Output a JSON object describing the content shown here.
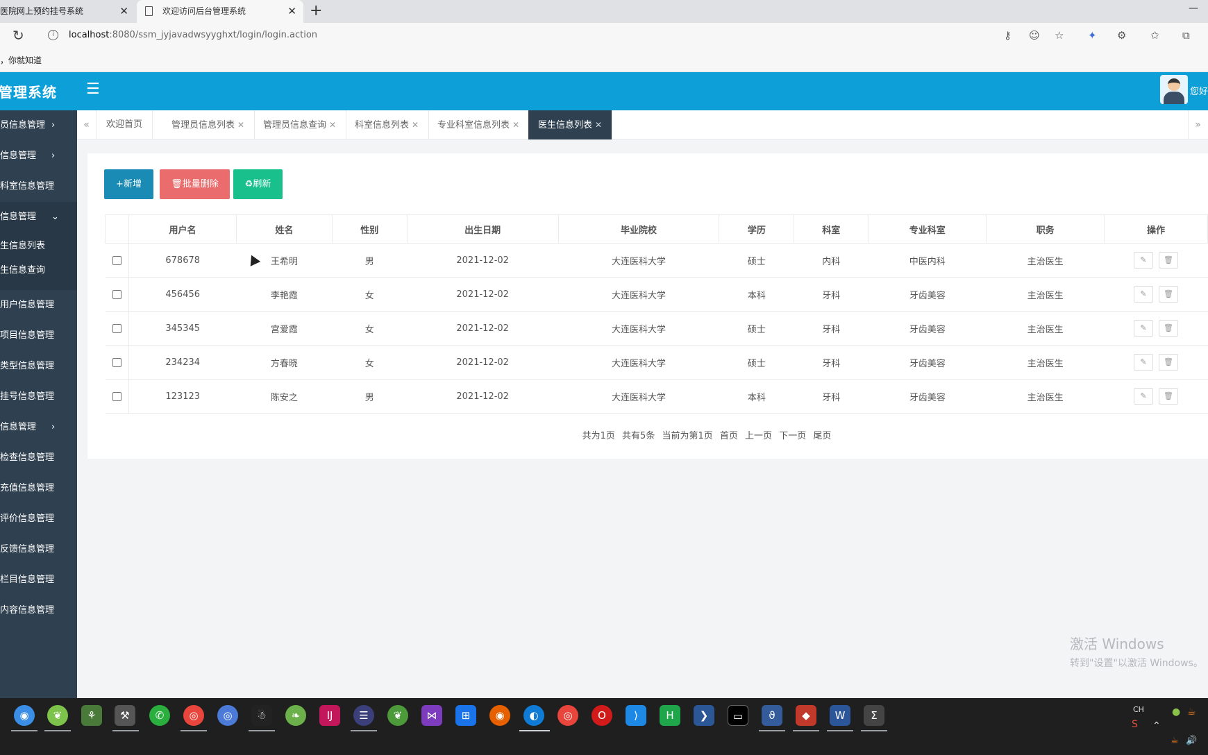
{
  "browser": {
    "tabs": [
      {
        "title": "医院网上预约挂号系统"
      },
      {
        "title": "欢迎访问后台管理系统"
      }
    ],
    "url_host": "localhost",
    "url_rest": ":8080/ssm_jyjavadwsyyghxt/login/login.action",
    "bookmark": "，你就知道"
  },
  "app": {
    "title": "管理系统",
    "greeting": "您好"
  },
  "sidebar": {
    "items": [
      {
        "label": "员信息管理"
      },
      {
        "label": "信息管理"
      },
      {
        "label": "科室信息管理"
      },
      {
        "label": "信息管理"
      },
      {
        "label": "生信息列表"
      },
      {
        "label": "生信息查询"
      },
      {
        "label": "用户信息管理"
      },
      {
        "label": "项目信息管理"
      },
      {
        "label": "类型信息管理"
      },
      {
        "label": "挂号信息管理"
      },
      {
        "label": "信息管理"
      },
      {
        "label": "检查信息管理"
      },
      {
        "label": "充值信息管理"
      },
      {
        "label": "评价信息管理"
      },
      {
        "label": "反馈信息管理"
      },
      {
        "label": "栏目信息管理"
      },
      {
        "label": "内容信息管理"
      }
    ]
  },
  "page_tabs": [
    {
      "label": "欢迎首页"
    },
    {
      "label": "管理员信息列表"
    },
    {
      "label": "管理员信息查询"
    },
    {
      "label": "科室信息列表"
    },
    {
      "label": "专业科室信息列表"
    },
    {
      "label": "医生信息列表"
    }
  ],
  "toolbar": {
    "add": "+新增",
    "batch_delete": "批量删除",
    "refresh": "刷新"
  },
  "table": {
    "headers": [
      "用户名",
      "姓名",
      "性别",
      "出生日期",
      "毕业院校",
      "学历",
      "科室",
      "专业科室",
      "职务",
      "操作"
    ],
    "rows": [
      [
        "678678",
        "王希明",
        "男",
        "2021-12-02",
        "大连医科大学",
        "硕士",
        "内科",
        "中医内科",
        "主治医生"
      ],
      [
        "456456",
        "李艳霞",
        "女",
        "2021-12-02",
        "大连医科大学",
        "本科",
        "牙科",
        "牙齿美容",
        "主治医生"
      ],
      [
        "345345",
        "宫爱霞",
        "女",
        "2021-12-02",
        "大连医科大学",
        "硕士",
        "牙科",
        "牙齿美容",
        "主治医生"
      ],
      [
        "234234",
        "方春晓",
        "女",
        "2021-12-02",
        "大连医科大学",
        "硕士",
        "牙科",
        "牙齿美容",
        "主治医生"
      ],
      [
        "123123",
        "陈安之",
        "男",
        "2021-12-02",
        "大连医科大学",
        "本科",
        "牙科",
        "牙齿美容",
        "主治医生"
      ]
    ]
  },
  "pagination": {
    "total_pages": "共为1页",
    "total_records": "共有5条",
    "current": "当前为第1页",
    "first": "首页",
    "prev": "上一页",
    "next": "下一页",
    "last": "尾页"
  },
  "watermark": {
    "line1": "激活 Windows",
    "line2": "转到\"设置\"以激活 Windows。"
  },
  "tray": {
    "lang": "CH"
  }
}
